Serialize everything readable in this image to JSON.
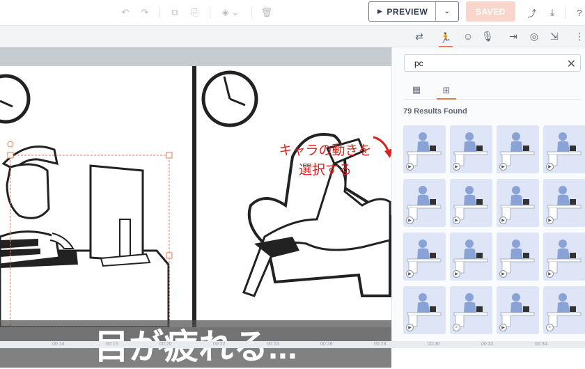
{
  "toolbar": {
    "preview_label": "PREVIEW",
    "preview_icon": "play-icon",
    "preview_dropdown_icon": "chevron-down-icon",
    "saved_label": "SAVED"
  },
  "scene": {
    "subtitle": "目が疲れる...",
    "annotation": "キャラの動きを選択する"
  },
  "panel": {
    "search_value": "pc",
    "results_text": "79 Results Found",
    "card_count": 16
  },
  "timeline": {
    "ticks": [
      "00:14",
      "00:15",
      "00:20",
      "00:22",
      "00:24",
      "00:26",
      "00:28",
      "00:30",
      "00:32",
      "00:34"
    ]
  },
  "colors": {
    "accent": "#e87a4f",
    "saved_bg": "#f9d5cc",
    "card_bg": "#dde5f7",
    "annotation": "#d9231e"
  }
}
